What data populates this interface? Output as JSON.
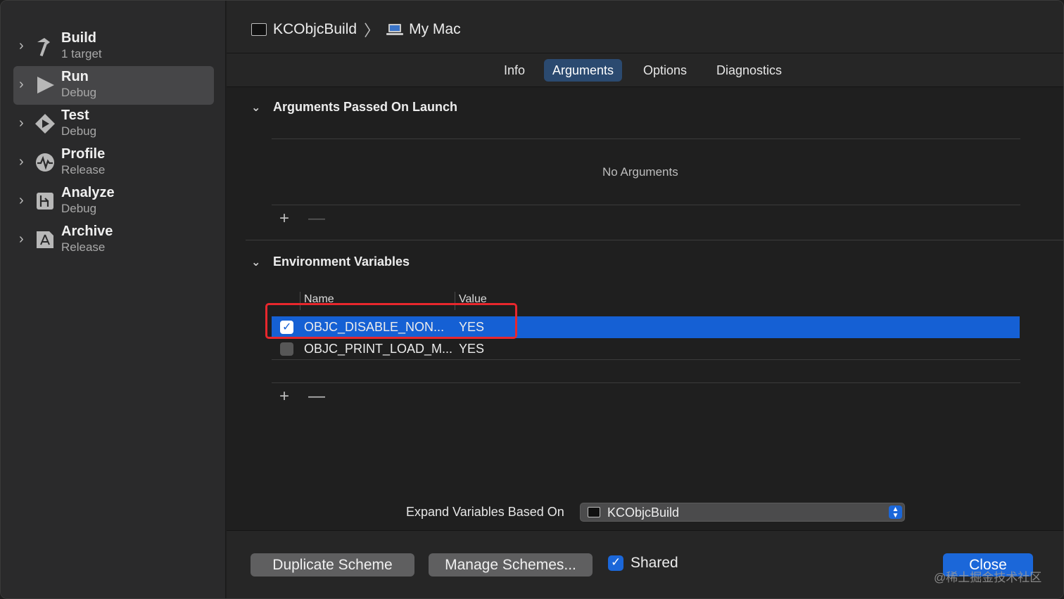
{
  "sidebar": {
    "items": [
      {
        "title": "Build",
        "sub": "1 target",
        "icon": "hammer-icon",
        "selected": false
      },
      {
        "title": "Run",
        "sub": "Debug",
        "icon": "play-icon",
        "selected": true
      },
      {
        "title": "Test",
        "sub": "Debug",
        "icon": "test-diamond-icon",
        "selected": false
      },
      {
        "title": "Profile",
        "sub": "Release",
        "icon": "waveform-icon",
        "selected": false
      },
      {
        "title": "Analyze",
        "sub": "Debug",
        "icon": "analyze-icon",
        "selected": false
      },
      {
        "title": "Archive",
        "sub": "Release",
        "icon": "archive-icon",
        "selected": false
      }
    ]
  },
  "header": {
    "scheme": "KCObjcBuild",
    "separator": "〉",
    "destination": "My Mac"
  },
  "tabs": [
    {
      "label": "Info",
      "active": false
    },
    {
      "label": "Arguments",
      "active": true
    },
    {
      "label": "Options",
      "active": false
    },
    {
      "label": "Diagnostics",
      "active": false
    }
  ],
  "arguments": {
    "title": "Arguments Passed On Launch",
    "empty_text": "No Arguments",
    "add": "+",
    "remove": "—"
  },
  "environment": {
    "title": "Environment Variables",
    "col_name": "Name",
    "col_value": "Value",
    "rows": [
      {
        "name": "OBJC_DISABLE_NON...",
        "value": "YES",
        "checked": true,
        "selected": true
      },
      {
        "name": "OBJC_PRINT_LOAD_M...",
        "value": "YES",
        "checked": false,
        "selected": false
      }
    ],
    "add": "+",
    "remove": "—"
  },
  "expand": {
    "label": "Expand Variables Based On",
    "value": "KCObjcBuild"
  },
  "footer": {
    "duplicate": "Duplicate Scheme",
    "manage": "Manage Schemes...",
    "shared_label": "Shared",
    "shared_checked": true,
    "close": "Close",
    "watermark": "@稀土掘金技术社区"
  },
  "colors": {
    "accent": "#1b67d9",
    "selection": "#1560d4",
    "highlight_box": "#e8272d"
  }
}
